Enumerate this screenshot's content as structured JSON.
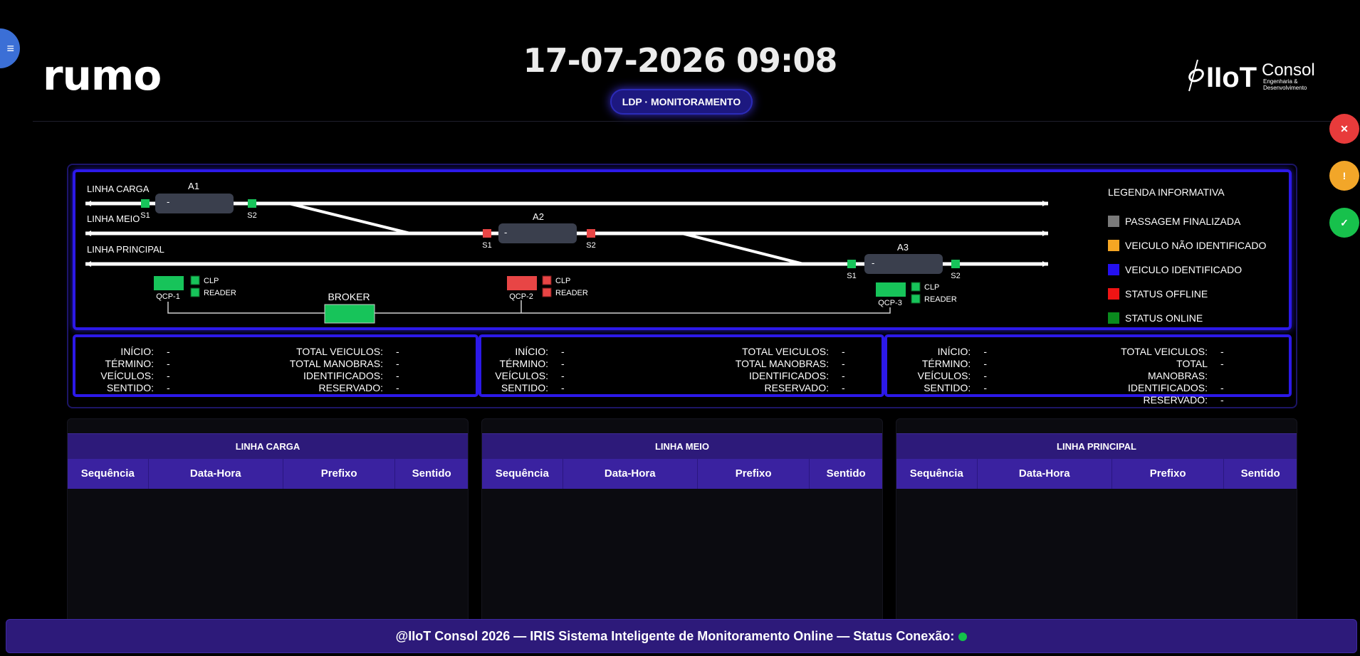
{
  "header": {
    "brand_left": "rumo",
    "brand_right_main": "IIoT",
    "brand_right_word": "Consol",
    "brand_right_sub1": "Engenharia &",
    "brand_right_sub2": "Desenvolvimento",
    "datetime": "17-07-2026 09:08",
    "mode_pill": "LDP · MONITORAMENTO"
  },
  "side_actions": {
    "error_symbol": "✕",
    "warning_symbol": "!",
    "ok_symbol": "✓",
    "colors": {
      "error": "#e83b3b",
      "warning": "#f2a629",
      "ok": "#17c14c"
    }
  },
  "diagram": {
    "lines": {
      "carga": "LINHA CARGA",
      "meio": "LINHA MEIO",
      "principal": "LINHA PRINCIPAL"
    },
    "areas": {
      "a1": {
        "label": "A1",
        "value": "-",
        "s1": "S1",
        "s2": "S2",
        "s1_status": "online",
        "s2_status": "online"
      },
      "a2": {
        "label": "A2",
        "value": "-",
        "s1": "S1",
        "s2": "S2",
        "s1_status": "offline",
        "s2_status": "offline"
      },
      "a3": {
        "label": "A3",
        "value": "-",
        "s1": "S1",
        "s2": "S2",
        "s1_status": "online",
        "s2_status": "online"
      }
    },
    "qcps": {
      "qcp1": {
        "label": "QCP-1",
        "clp": "CLP",
        "reader": "READER",
        "status": "online"
      },
      "qcp2": {
        "label": "QCP-2",
        "clp": "CLP",
        "reader": "READER",
        "status": "offline"
      },
      "qcp3": {
        "label": "QCP-3",
        "clp": "CLP",
        "reader": "READER",
        "status": "online"
      }
    },
    "broker": "BROKER",
    "legend": {
      "title": "LEGENDA INFORMATIVA",
      "items": [
        {
          "label": "PASSAGEM FINALIZADA",
          "color": "#7a7a7a"
        },
        {
          "label": "VEICULO NÃO IDENTIFICADO",
          "color": "#f5a623"
        },
        {
          "label": "VEICULO IDENTIFICADO",
          "color": "#2410f0"
        },
        {
          "label": "STATUS OFFLINE",
          "color": "#f01414"
        },
        {
          "label": "STATUS ONLINE",
          "color": "#0a8a1e"
        }
      ]
    },
    "colors": {
      "online": "#17c45a",
      "offline": "#e84545",
      "wagon": "#3a3f4d"
    }
  },
  "stats": [
    {
      "left": [
        {
          "label": "INÍCIO:",
          "value": "-"
        },
        {
          "label": "TÉRMINO:",
          "value": "-"
        },
        {
          "label": "VEÍCULOS:",
          "value": "-"
        },
        {
          "label": "SENTIDO:",
          "value": "-"
        }
      ],
      "right": [
        {
          "label": "TOTAL VEICULOS:",
          "value": "-"
        },
        {
          "label": "TOTAL MANOBRAS:",
          "value": "-"
        },
        {
          "label": "IDENTIFICADOS:",
          "value": "-"
        },
        {
          "label": "RESERVADO:",
          "value": "-"
        }
      ]
    },
    {
      "left": [
        {
          "label": "INÍCIO:",
          "value": "-"
        },
        {
          "label": "TÉRMINO:",
          "value": "-"
        },
        {
          "label": "VEÍCULOS:",
          "value": "-"
        },
        {
          "label": "SENTIDO:",
          "value": "-"
        }
      ],
      "right": [
        {
          "label": "TOTAL VEICULOS:",
          "value": "-"
        },
        {
          "label": "TOTAL MANOBRAS:",
          "value": "-"
        },
        {
          "label": "IDENTIFICADOS:",
          "value": "-"
        },
        {
          "label": "RESERVADO:",
          "value": "-"
        }
      ]
    },
    {
      "left": [
        {
          "label": "INÍCIO:",
          "value": "-"
        },
        {
          "label": "TÉRMINO:",
          "value": "-"
        },
        {
          "label": "VEÍCULOS:",
          "value": "-"
        },
        {
          "label": "SENTIDO:",
          "value": "-"
        }
      ],
      "right": [
        {
          "label": "TOTAL VEICULOS:",
          "value": "-"
        },
        {
          "label": "TOTAL MANOBRAS:",
          "value": "-"
        },
        {
          "label": "IDENTIFICADOS:",
          "value": "-"
        },
        {
          "label": "RESERVADO:",
          "value": "-"
        }
      ]
    }
  ],
  "tables": [
    {
      "title": "LINHA CARGA",
      "columns": [
        "Sequência",
        "Data-Hora",
        "Prefixo",
        "Sentido"
      ],
      "rows": []
    },
    {
      "title": "LINHA MEIO",
      "columns": [
        "Sequência",
        "Data-Hora",
        "Prefixo",
        "Sentido"
      ],
      "rows": []
    },
    {
      "title": "LINHA PRINCIPAL",
      "columns": [
        "Sequência",
        "Data-Hora",
        "Prefixo",
        "Sentido"
      ],
      "rows": []
    }
  ],
  "footer": {
    "text": "@IIoT Consol 2026  —  IRIS Sistema Inteligente de Monitoramento Online  —  Status Conexão:",
    "connection_status": "online"
  }
}
